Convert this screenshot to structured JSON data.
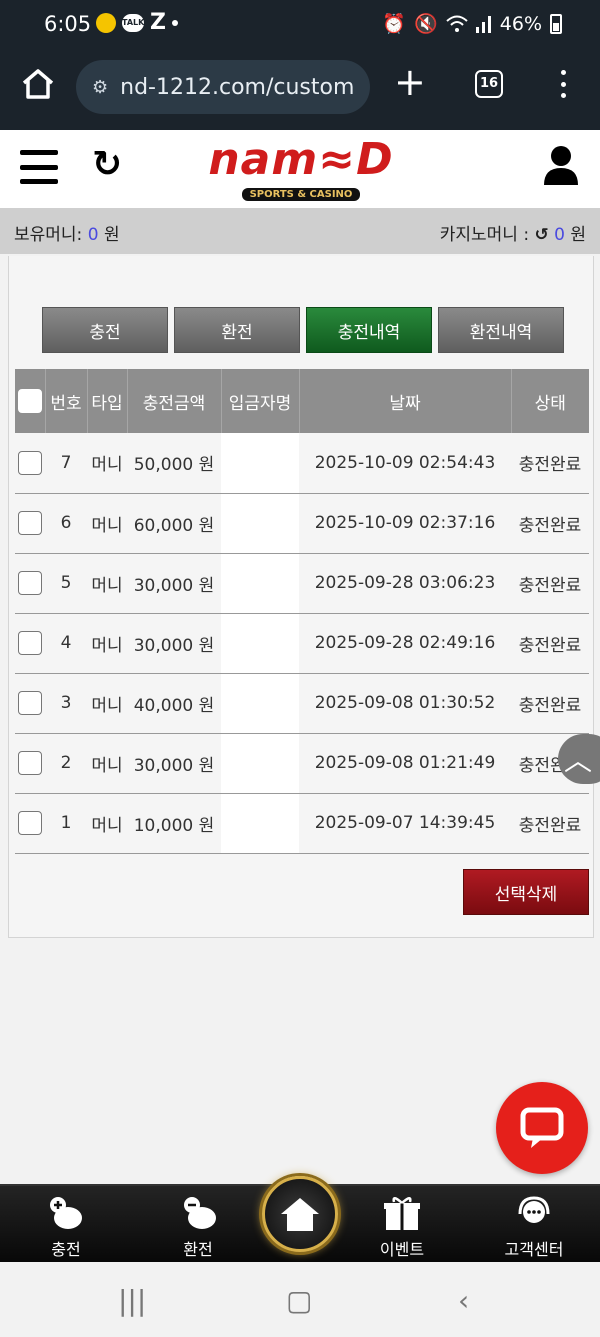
{
  "status_bar": {
    "time": "6:05",
    "talk_label": "TALK",
    "battery": "46%"
  },
  "browser": {
    "url": "nd-1212.com/custom",
    "tab_count": "16"
  },
  "header": {
    "logo_text": "nam≈D",
    "logo_sub": "SPORTS & CASINO"
  },
  "balance": {
    "money_label": "보유머니:",
    "money_value": "0",
    "money_unit": "원",
    "casino_label": "카지노머니 :",
    "casino_value": "0",
    "casino_unit": "원"
  },
  "tabs": [
    {
      "label": "충전",
      "active": false
    },
    {
      "label": "환전",
      "active": false
    },
    {
      "label": "충전내역",
      "active": true
    },
    {
      "label": "환전내역",
      "active": false
    }
  ],
  "table": {
    "headers": [
      "번호",
      "타입",
      "충전금액",
      "입금자명",
      "날짜",
      "상태"
    ],
    "rows": [
      {
        "no": "7",
        "type": "머니",
        "amount": "50,000 원",
        "depositor": "",
        "date": "2025-10-09 02:54:43",
        "status": "충전완료"
      },
      {
        "no": "6",
        "type": "머니",
        "amount": "60,000 원",
        "depositor": "",
        "date": "2025-10-09 02:37:16",
        "status": "충전완료"
      },
      {
        "no": "5",
        "type": "머니",
        "amount": "30,000 원",
        "depositor": "",
        "date": "2025-09-28 03:06:23",
        "status": "충전완료"
      },
      {
        "no": "4",
        "type": "머니",
        "amount": "30,000 원",
        "depositor": "",
        "date": "2025-09-28 02:49:16",
        "status": "충전완료"
      },
      {
        "no": "3",
        "type": "머니",
        "amount": "40,000 원",
        "depositor": "",
        "date": "2025-09-08 01:30:52",
        "status": "충전완료"
      },
      {
        "no": "2",
        "type": "머니",
        "amount": "30,000 원",
        "depositor": "",
        "date": "2025-09-08 01:21:49",
        "status": "충전완료"
      },
      {
        "no": "1",
        "type": "머니",
        "amount": "10,000 원",
        "depositor": "",
        "date": "2025-09-07 14:39:45",
        "status": "충전완료"
      }
    ]
  },
  "delete_button": "선택삭제",
  "bottom_nav": {
    "deposit": "충전",
    "withdraw": "환전",
    "event": "이벤트",
    "support": "고객센터"
  },
  "colors": {
    "accent_red": "#d01c1c",
    "active_tab": "#1a6e2c",
    "delete_btn": "#8e1218",
    "chat_fab": "#e5201b"
  }
}
